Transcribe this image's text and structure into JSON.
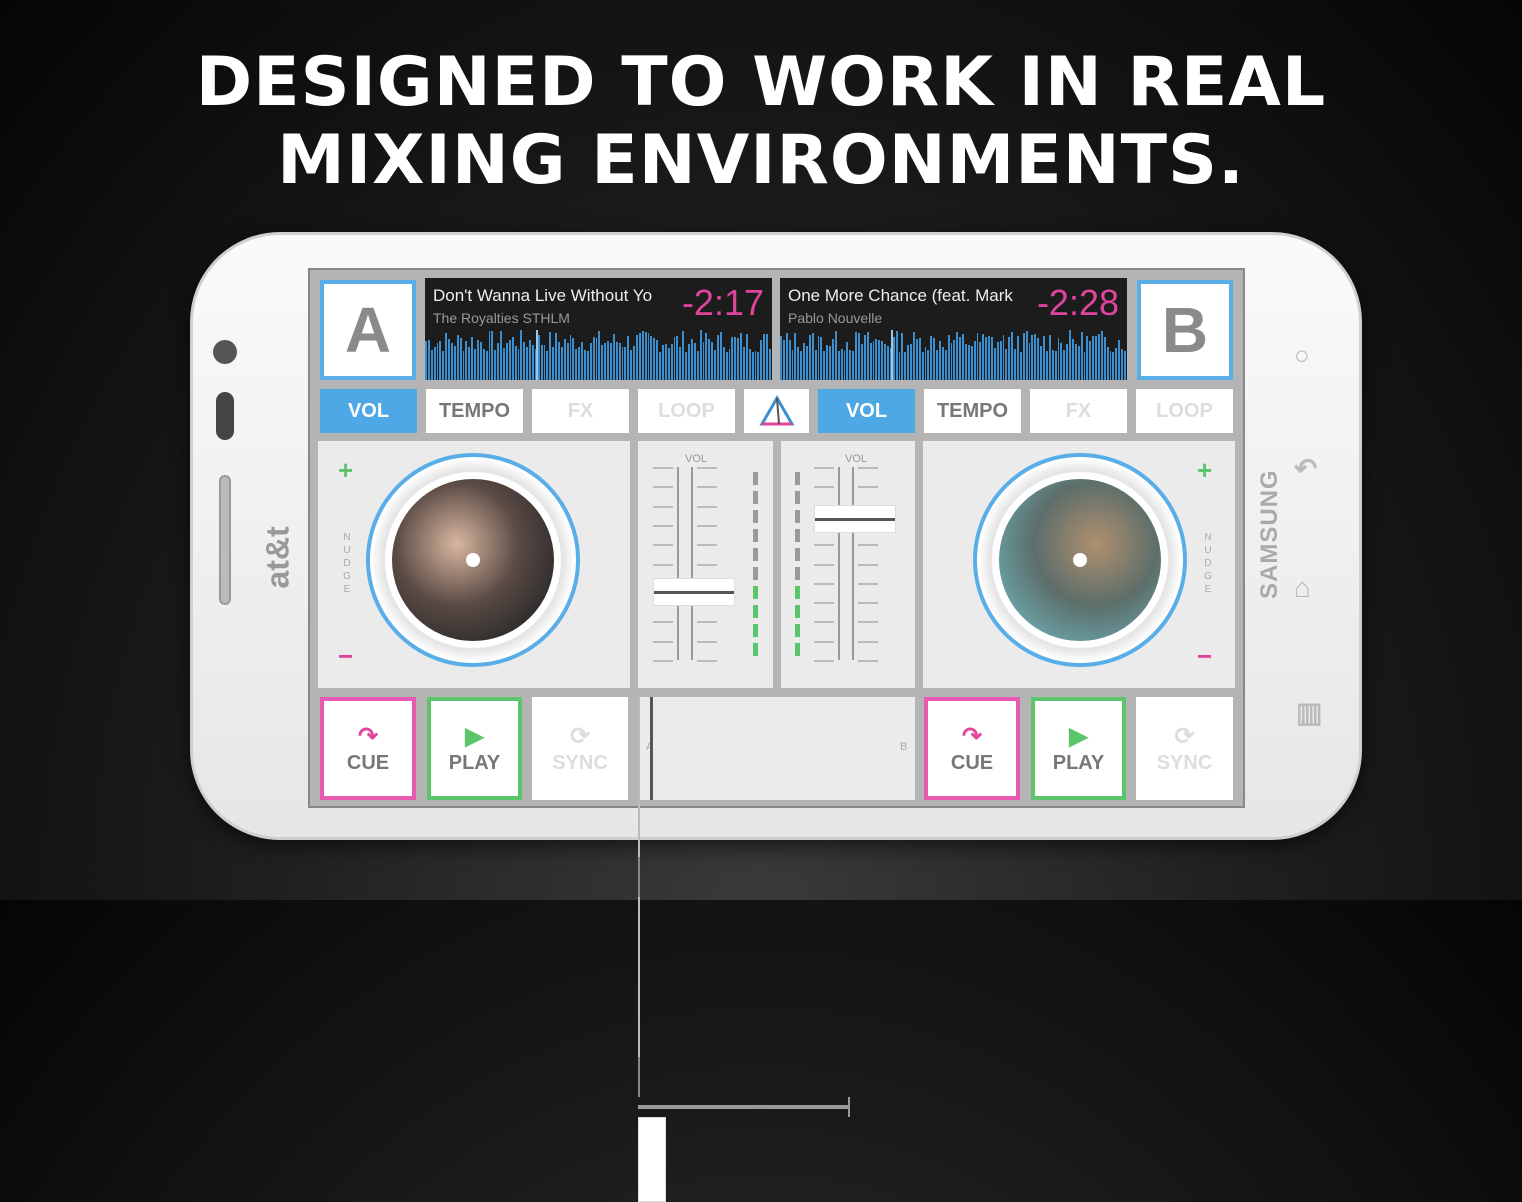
{
  "headline": {
    "line1": "DESIGNED TO WORK IN REAL",
    "line2": "MIXING ENVIRONMENTS."
  },
  "phone": {
    "carrier": "at&t",
    "brand": "SAMSUNG"
  },
  "deck_a": {
    "letter": "A",
    "title": "Don't Wanna Live Without Yo",
    "artist": "The Royalties STHLM",
    "time": "-2:17",
    "tabs": [
      "VOL",
      "TEMPO",
      "FX",
      "LOOP"
    ],
    "active_tab": "VOL",
    "nudge": "NUDGE",
    "plus": "+",
    "minus": "−",
    "cue": "CUE",
    "play": "PLAY",
    "sync": "SYNC",
    "volume_level": 0.35,
    "meter_lit": 4,
    "meter_total": 10,
    "playhead": 0.32
  },
  "deck_b": {
    "letter": "B",
    "title": "One More Chance (feat. Mark",
    "artist": "Pablo Nouvelle",
    "time": "-2:28",
    "tabs": [
      "VOL",
      "TEMPO",
      "FX",
      "LOOP"
    ],
    "active_tab": "VOL",
    "nudge": "NUDGE",
    "plus": "+",
    "minus": "−",
    "cue": "CUE",
    "play": "PLAY",
    "sync": "SYNC",
    "volume_level": 0.73,
    "meter_lit": 4,
    "meter_total": 10,
    "playhead": 0.32
  },
  "mixer": {
    "vol_label": "VOL",
    "crossfader_a": "A",
    "crossfader_b": "B",
    "crossfader_position": 0.0
  },
  "colors": {
    "accent_blue": "#4fa8e6",
    "pink": "#e0449c",
    "green": "#5cc46a"
  },
  "icons": {
    "cue": "cue-arrow-icon",
    "play": "play-icon",
    "sync": "sync-icon",
    "logo": "triangle-logo-icon",
    "nav": [
      "search-icon",
      "back-icon",
      "home-icon",
      "menu-icon"
    ]
  }
}
